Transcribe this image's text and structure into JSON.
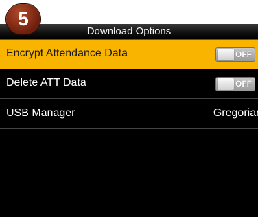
{
  "step_number": "5",
  "header": {
    "title": "Download Options"
  },
  "menu": {
    "items": [
      {
        "label": "Encrypt Attendance Data",
        "toggle": "OFF",
        "selected": true
      },
      {
        "label": "Delete ATT Data",
        "toggle": "OFF",
        "selected": false
      },
      {
        "label": "USB Manager",
        "value": "Gregorian",
        "selected": false
      }
    ]
  },
  "colors": {
    "selected_row": "#f9b400",
    "background": "#000000",
    "badge": "#8b2c14"
  }
}
